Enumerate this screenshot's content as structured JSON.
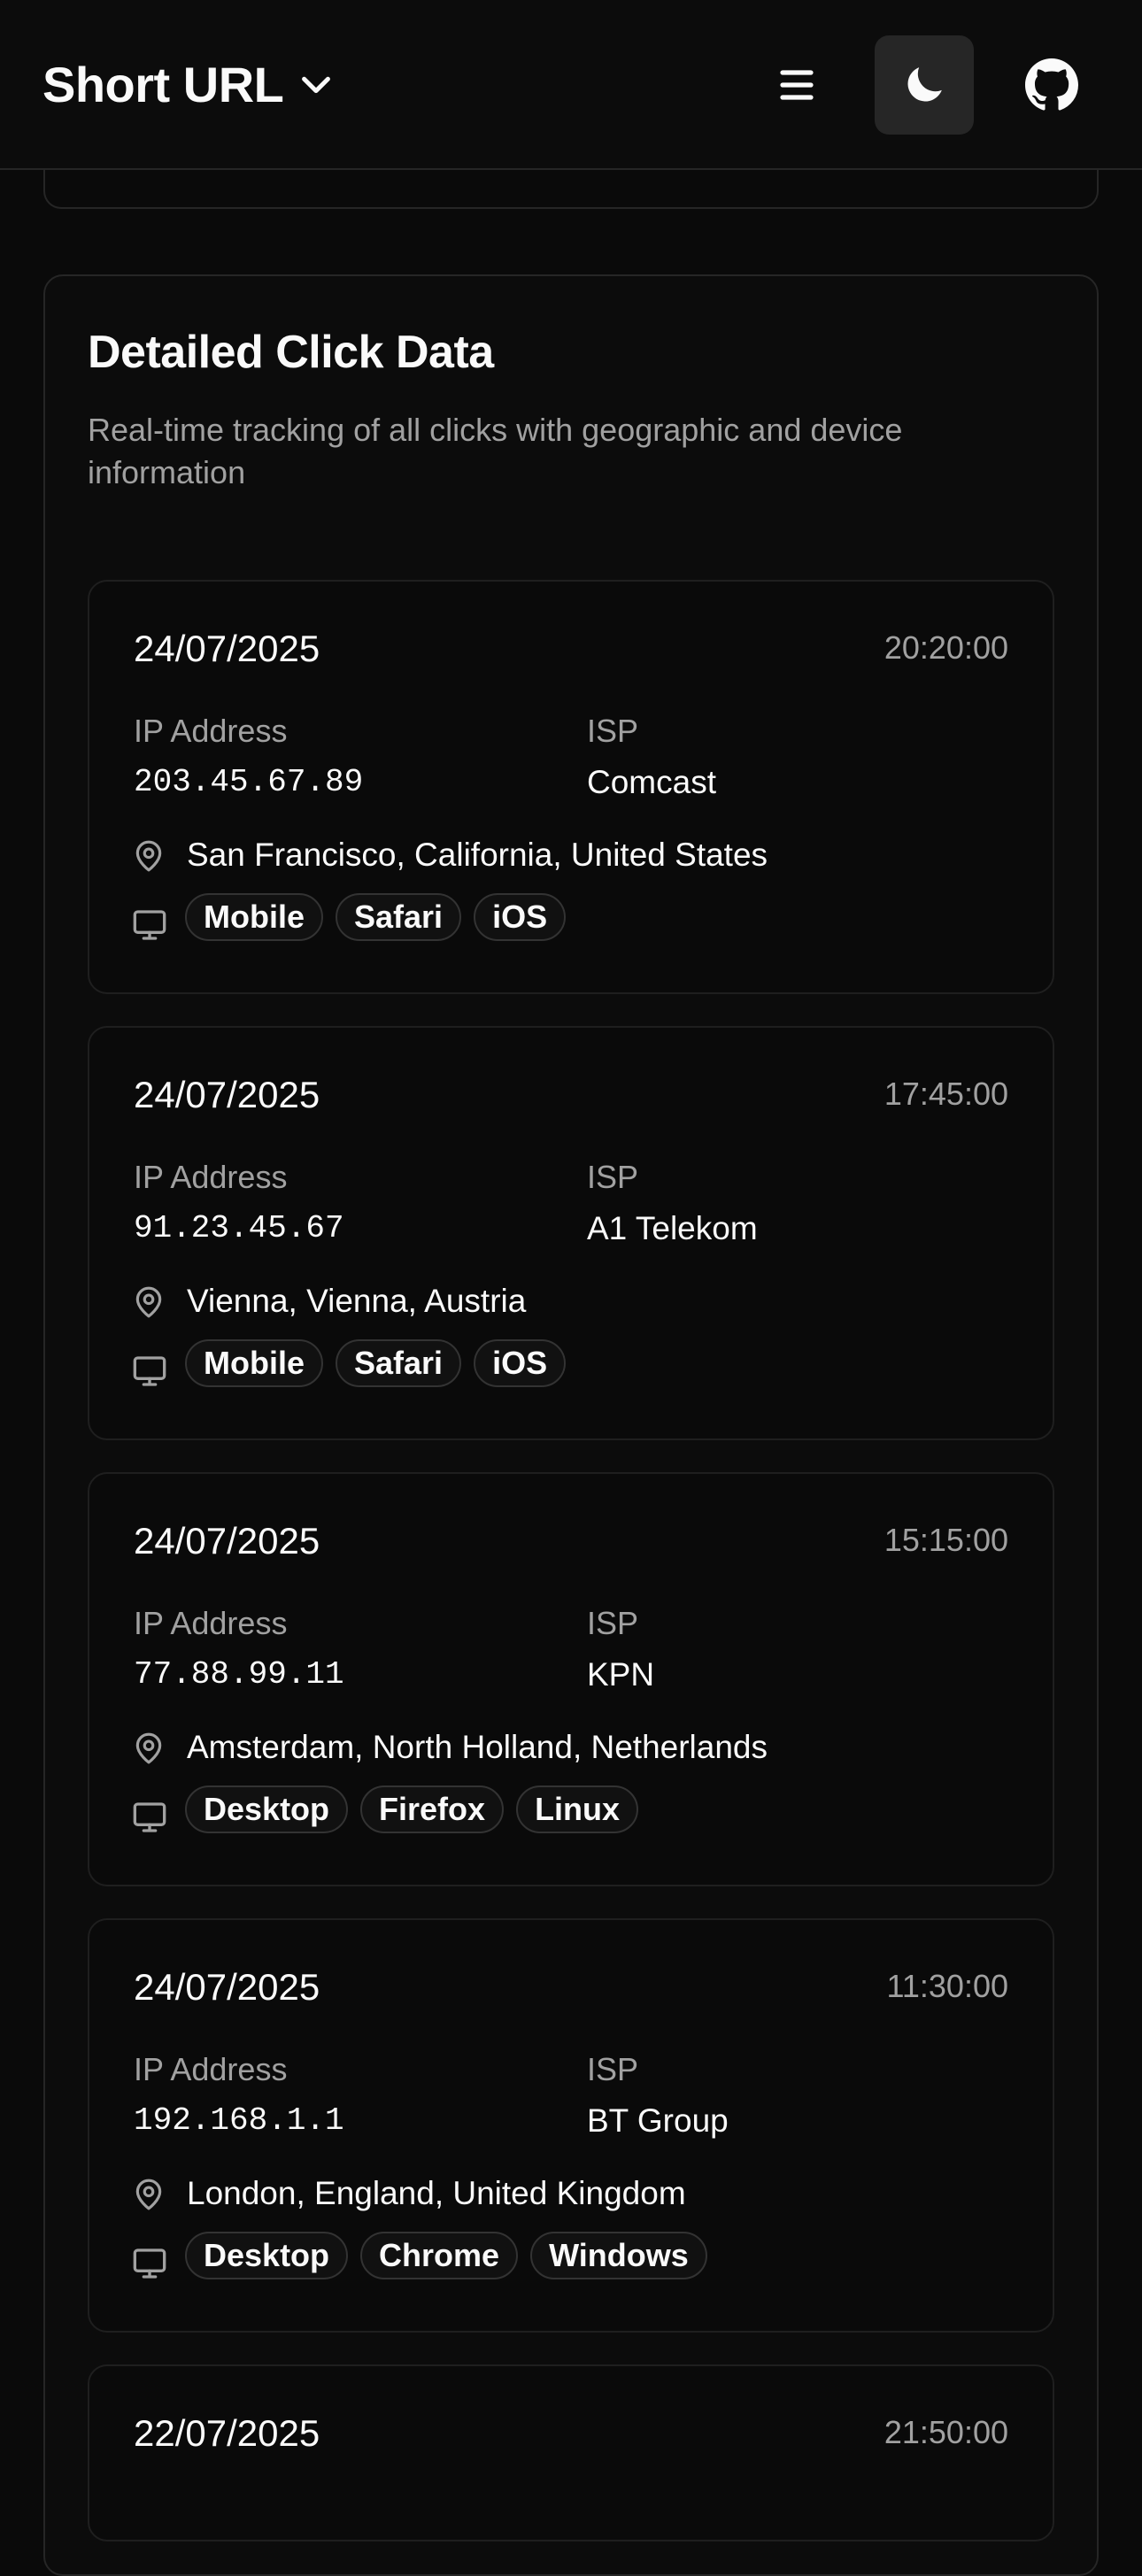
{
  "header": {
    "title": "Short URL",
    "icons": {
      "brand_chevron": "chevron-down-icon",
      "menu": "menu-icon",
      "theme": "moon-icon",
      "github": "github-icon"
    }
  },
  "section": {
    "title": "Detailed Click Data",
    "description": "Real-time tracking of all clicks with geographic and device information"
  },
  "labels": {
    "ip": "IP Address",
    "isp": "ISP"
  },
  "clicks": [
    {
      "date": "24/07/2025",
      "time": "20:20:00",
      "ip": "203.45.67.89",
      "isp": "Comcast",
      "location": "San Francisco, California, United States",
      "tags": [
        "Mobile",
        "Safari",
        "iOS"
      ]
    },
    {
      "date": "24/07/2025",
      "time": "17:45:00",
      "ip": "91.23.45.67",
      "isp": "A1 Telekom",
      "location": "Vienna, Vienna, Austria",
      "tags": [
        "Mobile",
        "Safari",
        "iOS"
      ]
    },
    {
      "date": "24/07/2025",
      "time": "15:15:00",
      "ip": "77.88.99.11",
      "isp": "KPN",
      "location": "Amsterdam, North Holland, Netherlands",
      "tags": [
        "Desktop",
        "Firefox",
        "Linux"
      ]
    },
    {
      "date": "24/07/2025",
      "time": "11:30:00",
      "ip": "192.168.1.1",
      "isp": "BT Group",
      "location": "London, England, United Kingdom",
      "tags": [
        "Desktop",
        "Chrome",
        "Windows"
      ]
    },
    {
      "date": "22/07/2025",
      "time": "21:50:00"
    }
  ],
  "colors": {
    "background": "#0a0a0a",
    "border": "#262626",
    "muted": "#a1a1a1",
    "text": "#fafafa"
  }
}
